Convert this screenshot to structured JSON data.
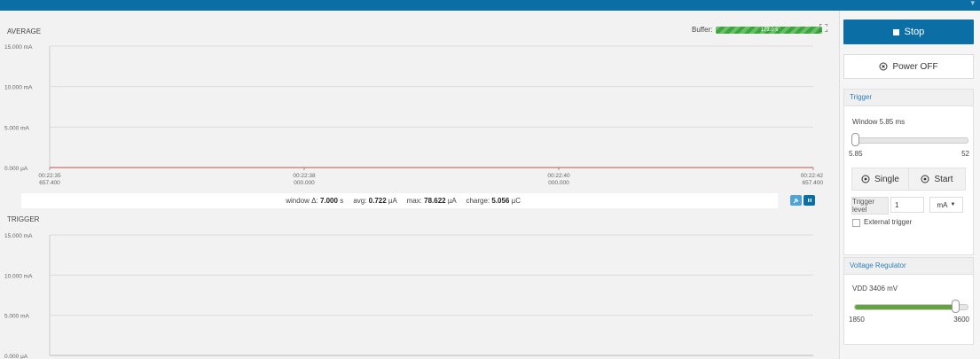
{
  "chart_data": [
    {
      "type": "line",
      "title": "AVERAGE",
      "x": [
        "00:22:35\n657.400",
        "00:22:38\n000.000",
        "00:22:40\n000.000",
        "00:22:42\n657.400"
      ],
      "y_ticks": [
        "15.000 mA",
        "10.000 mA",
        "5.000 mA",
        "0.000 µA"
      ],
      "ylim": [
        0,
        15
      ],
      "y_unit": "mA",
      "series": [
        {
          "values": [
            0,
            0,
            0,
            0
          ],
          "color": "#c0504d"
        }
      ],
      "grid": true
    },
    {
      "type": "line",
      "title": "TRIGGER",
      "y_ticks": [
        "15.000 mA",
        "10.000 mA",
        "5.000 mA",
        "0.000 µA"
      ],
      "ylim": [
        0,
        15
      ],
      "y_unit": "mA",
      "series": [],
      "grid": true
    }
  ],
  "buffer": {
    "label": "Buffer:",
    "value": "173.0 s",
    "fill_fraction": 1.0
  },
  "stats": {
    "window_label": "window Δ: ",
    "window_value": "7.000",
    "window_unit": " s",
    "avg_label": "avg: ",
    "avg_value": "0.722",
    "avg_unit": " µA",
    "max_label": "max: ",
    "max_value": "78.622",
    "max_unit": " µA",
    "charge_label": "charge: ",
    "charge_value": "5.056",
    "charge_unit": " µC"
  },
  "controls": {
    "stop_label": "Stop",
    "power_label": "Power OFF",
    "trigger": {
      "header": "Trigger",
      "window_label": "Window 5.85 ms",
      "slider_min": "5.85",
      "slider_max": "52",
      "slider_fraction": 0.0,
      "single_label": "Single",
      "start_label": "Start",
      "level_label": "Trigger level",
      "level_value": "1",
      "level_unit": "mA",
      "external_label": "External trigger"
    },
    "regulator": {
      "header": "Voltage Regulator",
      "vdd_label": "VDD 3406 mV",
      "slider_min": "1850",
      "slider_max": "3600",
      "slider_fraction": 0.89
    }
  },
  "colors": {
    "accent": "#0b6fa6",
    "slider_green": "#63a33d",
    "trace": "#c0504d"
  },
  "icons": [
    "stop-icon",
    "power-icon",
    "radio-icon",
    "expand-icon",
    "pin-icon",
    "pause-icon",
    "caret-down-icon"
  ]
}
